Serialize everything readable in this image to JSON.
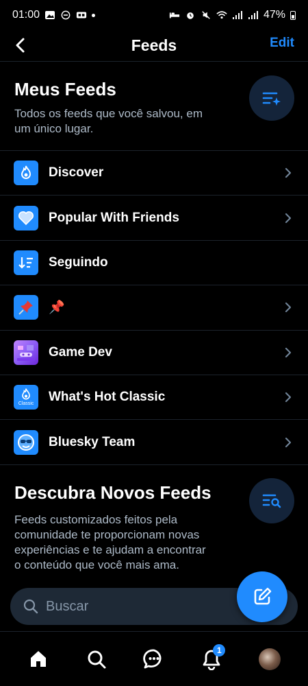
{
  "status_bar": {
    "time": "01:00",
    "battery": "47%"
  },
  "header": {
    "title": "Feeds",
    "edit_label": "Edit"
  },
  "my_feeds": {
    "title": "Meus Feeds",
    "description_line1": "Todos os feeds que você salvou, em",
    "description_line2": "um único lugar."
  },
  "feeds": [
    {
      "label": "Discover",
      "icon": "discover-feed-icon",
      "has_chevron": true
    },
    {
      "label": "Popular With Friends",
      "icon": "heart-feed-icon",
      "has_chevron": true
    },
    {
      "label": "Seguindo",
      "icon": "following-feed-icon",
      "has_chevron": false
    },
    {
      "label": "📌",
      "icon": "pushpin-feed-icon",
      "has_chevron": true
    },
    {
      "label": "Game Dev",
      "icon": "game-dev-feed-icon",
      "has_chevron": true
    },
    {
      "label": "What's Hot Classic",
      "icon": "whats-hot-classic-feed-icon",
      "avatar_caption": "Classic",
      "has_chevron": true
    },
    {
      "label": "Bluesky Team",
      "icon": "bluesky-team-feed-icon",
      "has_chevron": true
    }
  ],
  "discover": {
    "title": "Descubra Novos Feeds",
    "description_lines": [
      "Feeds customizados feitos pela",
      "comunidade te proporcionam novas",
      "experiências e te ajudam a encontrar",
      "o conteúdo que você mais ama."
    ]
  },
  "search": {
    "placeholder": "Buscar"
  },
  "bottom_nav": {
    "notifications_badge": "1"
  },
  "colors": {
    "accent": "#208bfe",
    "background": "#000000",
    "muted_text": "#aebbc9",
    "divider": "#1c232c"
  }
}
